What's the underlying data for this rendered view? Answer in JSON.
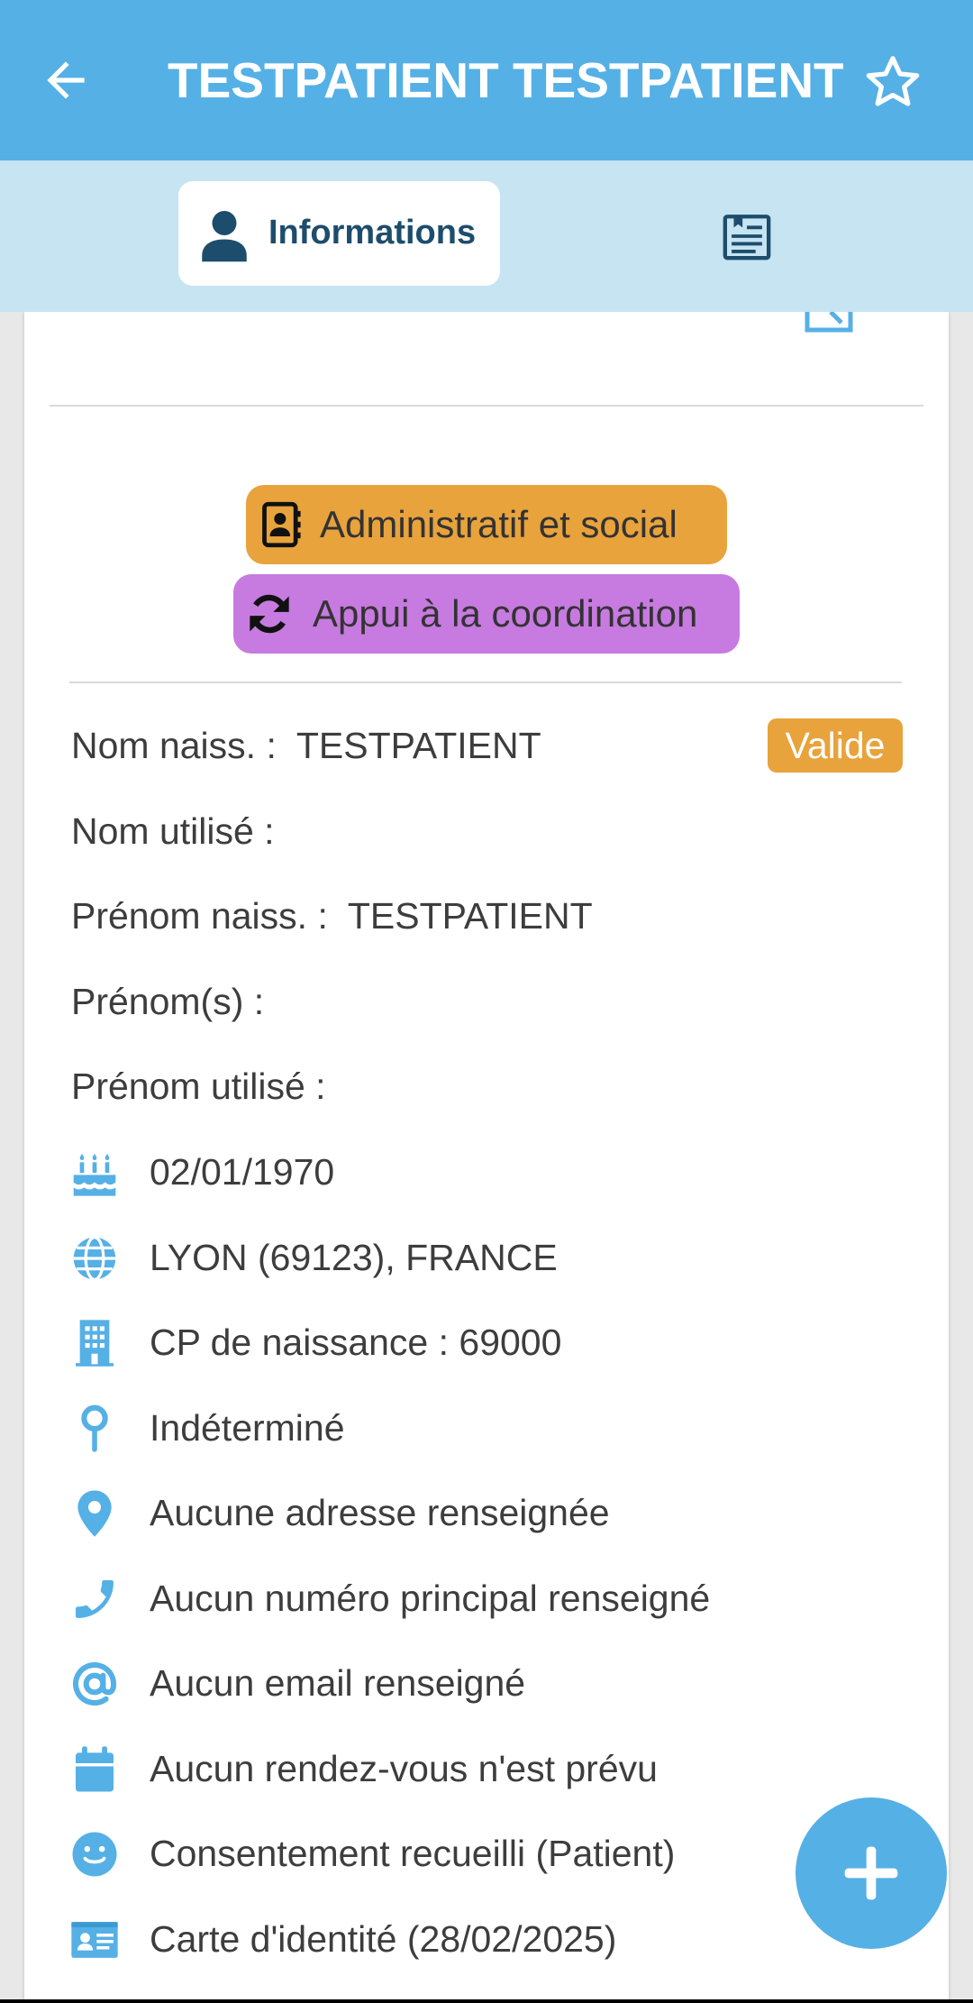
{
  "colors": {
    "primary": "#55b0e6",
    "tabbar": "#c6e4f2",
    "admin": "#e8a33c",
    "coordination": "#c77ae0",
    "valid_badge": "#e8a33c",
    "icon": "#55b0e6",
    "tab_text": "#1d4d6c"
  },
  "header": {
    "title": "TESTPATIENT TESTPATIENT",
    "back_icon": "arrow-left-icon",
    "favorite_icon": "star-outline-icon"
  },
  "tabs": [
    {
      "label": "Informations",
      "icon": "person-icon",
      "selected": true
    },
    {
      "label": "",
      "icon": "notes-list-icon",
      "selected": false
    }
  ],
  "actions": {
    "admin_label": "Administratif et social",
    "coordination_label": "Appui à la coordination"
  },
  "identity": {
    "birth_name_label": "Nom naiss. :",
    "birth_name_value": "TESTPATIENT",
    "status_badge": "Valide",
    "used_name_label": "Nom utilisé :",
    "birth_firstname_label": "Prénom naiss. :",
    "birth_firstname_value": "TESTPATIENT",
    "firstnames_label": "Prénom(s) :",
    "used_firstname_label": "Prénom utilisé :"
  },
  "details": [
    {
      "icon": "birthday-cake-icon",
      "text": "02/01/1970"
    },
    {
      "icon": "globe-icon",
      "text": "LYON (69123), FRANCE"
    },
    {
      "icon": "building-icon",
      "text": "CP de naissance : 69000"
    },
    {
      "icon": "map-pin-icon",
      "text": "Indéterminé"
    },
    {
      "icon": "location-marker-icon",
      "text": "Aucune adresse renseignée"
    },
    {
      "icon": "phone-icon",
      "text": "Aucun numéro principal renseigné"
    },
    {
      "icon": "at-sign-icon",
      "text": "Aucun email renseigné"
    },
    {
      "icon": "calendar-icon",
      "text": "Aucun rendez-vous n'est prévu"
    },
    {
      "icon": "smiley-icon",
      "text": "Consentement recueilli (Patient)"
    },
    {
      "icon": "id-card-icon",
      "text": "Carte d'identité (28/02/2025)"
    }
  ],
  "fab": {
    "icon": "plus-icon"
  }
}
